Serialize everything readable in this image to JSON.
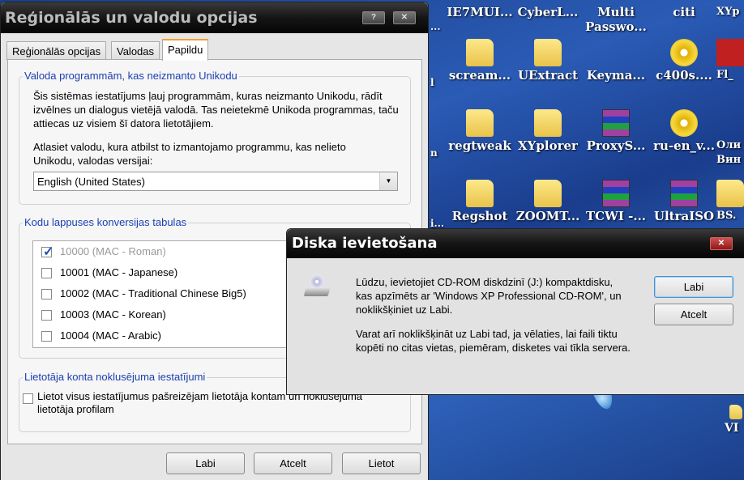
{
  "desktop": {
    "icons": [
      {
        "label": "IE7MUI...",
        "type": "none"
      },
      {
        "label": "CyberL...",
        "type": "none"
      },
      {
        "label": "Multi Passwo...",
        "type": "none"
      },
      {
        "label": "citi",
        "type": "none"
      },
      {
        "label": "XYp",
        "type": "none"
      },
      {
        "label": "scream...",
        "type": "folder"
      },
      {
        "label": "UExtract",
        "type": "folder"
      },
      {
        "label": "Keyma...",
        "type": "window"
      },
      {
        "label": "c400s....",
        "type": "cd"
      },
      {
        "label": "Fl_",
        "type": "red"
      },
      {
        "label": "regtweak",
        "type": "folder"
      },
      {
        "label": "XYplorer",
        "type": "folder"
      },
      {
        "label": "ProxyS...",
        "type": "rar"
      },
      {
        "label": "ru-en_v...",
        "type": "cd"
      },
      {
        "label": "Оли Вин",
        "type": "window"
      },
      {
        "label": "Regshot",
        "type": "folder"
      },
      {
        "label": "ZOOMT...",
        "type": "folder"
      },
      {
        "label": "TCWI -...",
        "type": "rar"
      },
      {
        "label": "UltraISO",
        "type": "rar"
      },
      {
        "label": "BS.",
        "type": "folder"
      }
    ],
    "partial_left": [
      "...",
      "l",
      "n",
      "i..."
    ],
    "partial_right": "VI"
  },
  "regional": {
    "title": "Reģionālās un valodu opcijas",
    "help": "?",
    "close": "✕",
    "tabs": [
      "Reģionālās opcijas",
      "Valodas",
      "Papildu"
    ],
    "group1": {
      "label": "Valoda programmām, kas neizmanto Unikodu",
      "desc": "Šis sistēmas iestatījums ļauj programmām, kuras neizmanto Unikodu, rādīt izvēlnes un dialogus vietējā valodā. Tas neietekmē Unikoda programmas, taču attiecas uz visiem šī datora lietotājiem.",
      "prompt": "Atlasiet valodu, kura atbilst to izmantojamo programmu, kas nelieto Unikodu, valodas versijai:",
      "selected": "English (United States)"
    },
    "group2": {
      "label": "Kodu lappuses konversijas tabulas",
      "items": [
        {
          "label": "10000 (MAC - Roman)",
          "checked": true,
          "disabled": true
        },
        {
          "label": "10001 (MAC - Japanese)",
          "checked": false
        },
        {
          "label": "10002 (MAC - Traditional Chinese Big5)",
          "checked": false
        },
        {
          "label": "10003 (MAC - Korean)",
          "checked": false
        },
        {
          "label": "10004 (MAC - Arabic)",
          "checked": false
        }
      ]
    },
    "group3": {
      "label": "Lietotāja konta noklusējuma iestatījumi",
      "checkbox": "Lietot visus iestatījumus pašreizējam lietotāja kontam un noklusējuma lietotāja profilam"
    },
    "buttons": {
      "ok": "Labi",
      "cancel": "Atcelt",
      "apply": "Lietot"
    }
  },
  "insert": {
    "title": "Diska ievietošana",
    "close": "✕",
    "line1": "Lūdzu, ievietojiet CD-ROM diskdzinī (J:) kompaktdisku, kas apzīmēts ar 'Windows XP Professional CD-ROM', un noklikšķiniet uz Labi.",
    "line2": "Varat arī noklikšķināt uz Labi tad, ja vēlaties, lai faili tiktu kopēti no citas vietas, piemēram, disketes vai tīkla servera.",
    "ok": "Labi",
    "cancel": "Atcelt"
  }
}
